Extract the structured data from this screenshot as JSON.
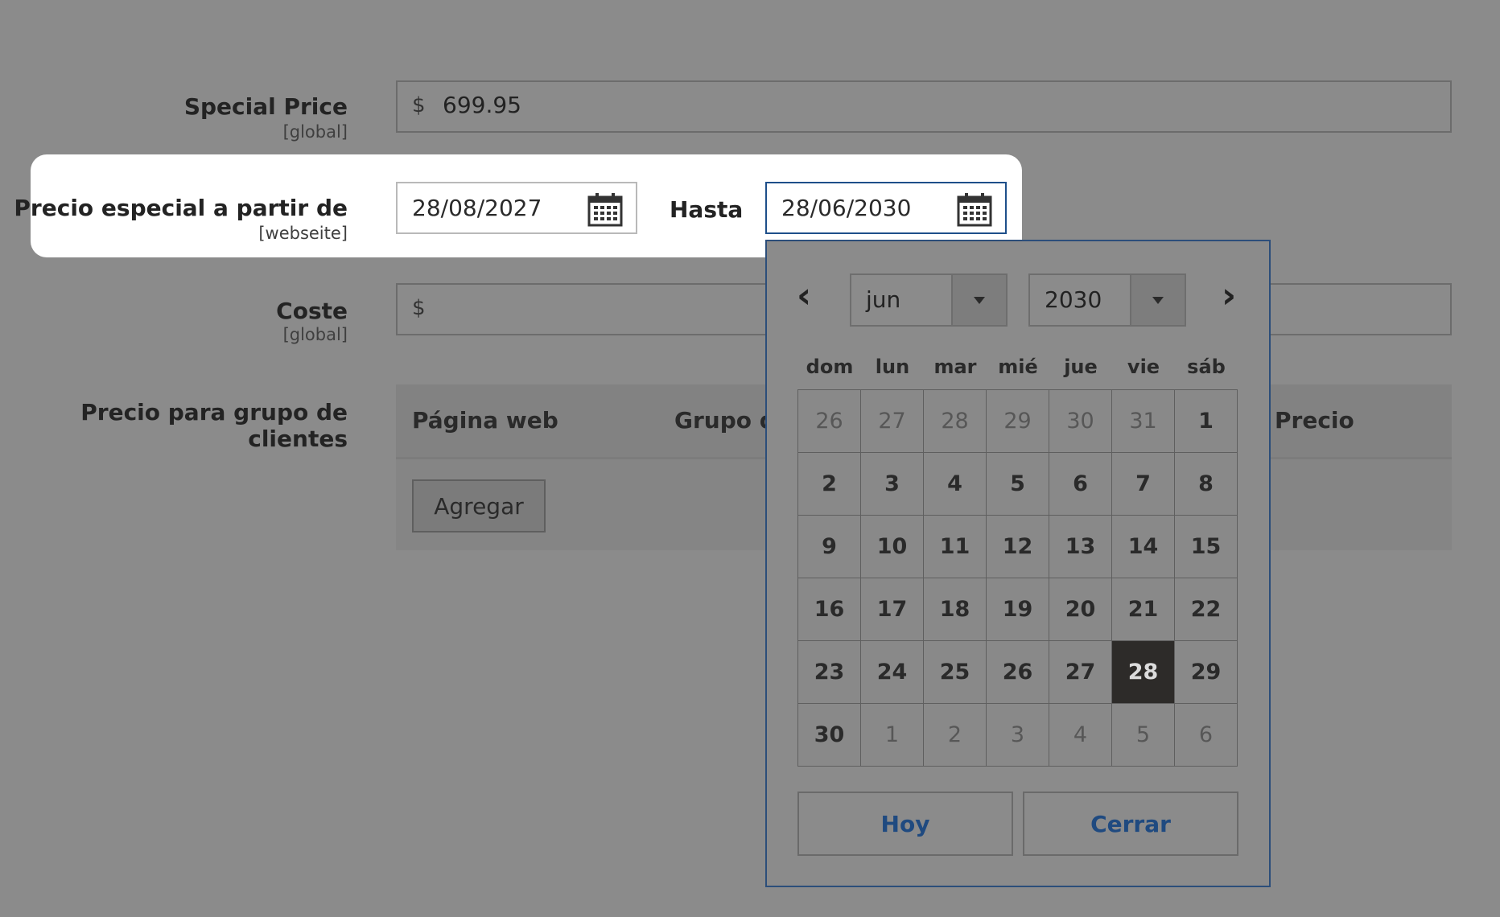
{
  "special_price": {
    "label": "Special Price",
    "scope": "[global]",
    "currency": "$",
    "value": "699.95"
  },
  "special_from": {
    "label": "Precio especial a partir de",
    "scope": "[webseite]",
    "from_value": "28/08/2027",
    "to_label": "Hasta",
    "to_value": "28/06/2030"
  },
  "cost": {
    "label": "Coste",
    "scope": "[global]",
    "currency": "$",
    "value": ""
  },
  "group_price": {
    "label": "Precio para grupo de clientes",
    "columns": [
      "Página web",
      "Grupo de",
      "Precio"
    ],
    "add_label": "Agregar"
  },
  "datepicker": {
    "prev": "‹",
    "next": "›",
    "month": "jun",
    "year": "2030",
    "weekdays": [
      "dom",
      "lun",
      "mar",
      "mié",
      "jue",
      "vie",
      "sáb"
    ],
    "days": [
      [
        "26",
        "27",
        "28",
        "29",
        "30",
        "31",
        "1"
      ],
      [
        "2",
        "3",
        "4",
        "5",
        "6",
        "7",
        "8"
      ],
      [
        "9",
        "10",
        "11",
        "12",
        "13",
        "14",
        "15"
      ],
      [
        "16",
        "17",
        "18",
        "19",
        "20",
        "21",
        "22"
      ],
      [
        "23",
        "24",
        "25",
        "26",
        "27",
        "28",
        "29"
      ],
      [
        "30",
        "1",
        "2",
        "3",
        "4",
        "5",
        "6"
      ]
    ],
    "other_month": [
      [
        true,
        true,
        true,
        true,
        true,
        true,
        false
      ],
      [
        false,
        false,
        false,
        false,
        false,
        false,
        false
      ],
      [
        false,
        false,
        false,
        false,
        false,
        false,
        false
      ],
      [
        false,
        false,
        false,
        false,
        false,
        false,
        false
      ],
      [
        false,
        false,
        false,
        false,
        false,
        false,
        false
      ],
      [
        false,
        true,
        true,
        true,
        true,
        true,
        true
      ]
    ],
    "selected_day": "28",
    "today_label": "Hoy",
    "close_label": "Cerrar"
  },
  "icons": {
    "calendar": "calendar-icon",
    "dropdown": "chevron-down-icon"
  },
  "colors": {
    "overlay": "#8b8b8b",
    "accent": "#1f4a80",
    "selected": "#2d2b29"
  }
}
